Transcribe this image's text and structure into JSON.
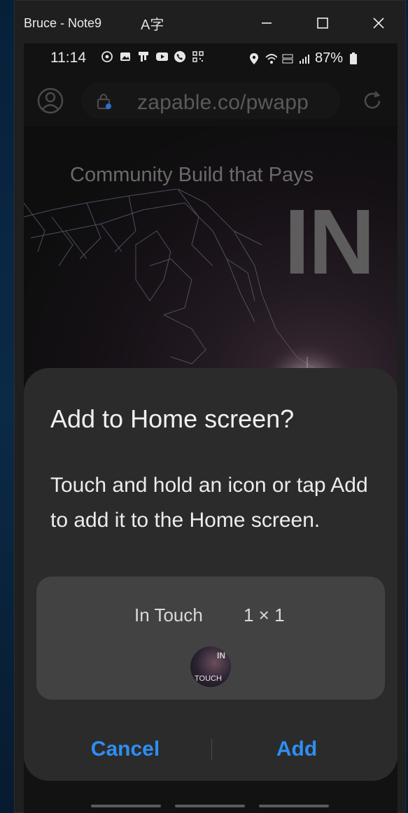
{
  "window": {
    "title": "Bruce - Note9",
    "lang_glyph": "A字"
  },
  "statusbar": {
    "time": "11:14",
    "battery": "87%"
  },
  "browser": {
    "url": "zapable.co/pwapp"
  },
  "hero": {
    "tagline": "Community Build that Pays",
    "brand": "IN"
  },
  "dialog": {
    "title": "Add to Home screen?",
    "body": "Touch and hold an icon or tap Add to add it to the Home screen.",
    "app_name": "In Touch",
    "app_size": "1 × 1",
    "icon_text_top": "IN",
    "icon_text_bottom": "TOUCH",
    "cancel_label": "Cancel",
    "add_label": "Add"
  },
  "colors": {
    "accent": "#2d8ff2",
    "dialog_bg": "#2b2b2b",
    "preview_bg": "#424242"
  }
}
